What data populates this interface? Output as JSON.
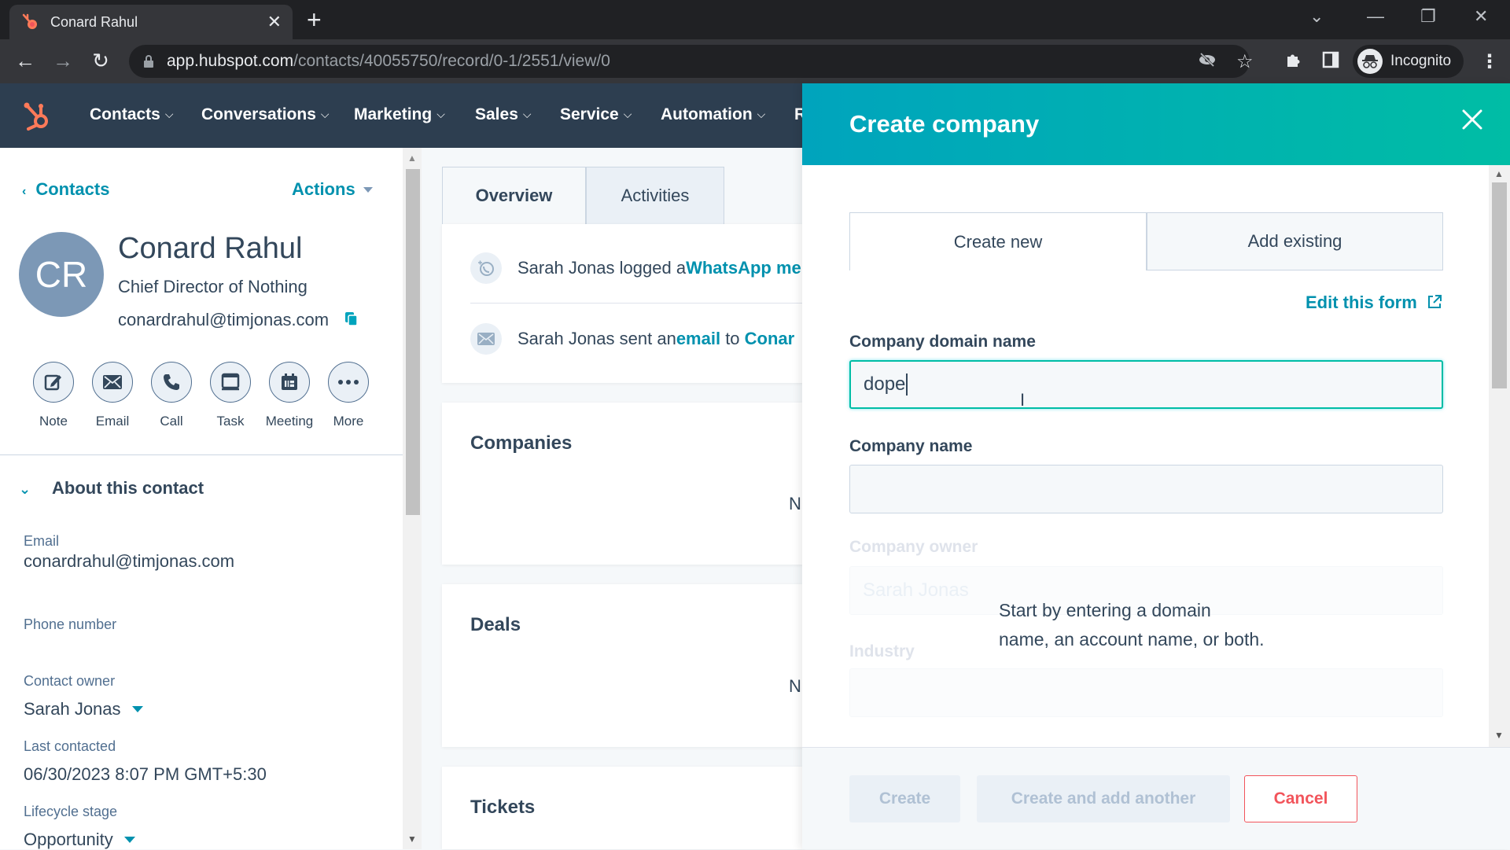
{
  "browser": {
    "tab_title": "Conard Rahul",
    "url_host": "app.hubspot.com",
    "url_path": "/contacts/40055750/record/0-1/2551/view/0",
    "profile_label": "Incognito"
  },
  "nav": {
    "items": [
      "Contacts",
      "Conversations",
      "Marketing",
      "Sales",
      "Service",
      "Automation",
      "R"
    ]
  },
  "sidebar": {
    "back_label": "Contacts",
    "actions_label": "Actions",
    "avatar_initials": "CR",
    "name": "Conard Rahul",
    "job_title": "Chief Director of Nothing",
    "email": "conardrahul@timjonas.com",
    "actions": [
      "Note",
      "Email",
      "Call",
      "Task",
      "Meeting",
      "More"
    ],
    "section_title": "About this contact",
    "properties": [
      {
        "label": "Email",
        "value": "conardrahul@timjonas.com"
      },
      {
        "label": "Phone number",
        "value": ""
      },
      {
        "label": "Contact owner",
        "value": "Sarah Jonas"
      },
      {
        "label": "Last contacted",
        "value": "06/30/2023 8:07 PM GMT+5:30"
      },
      {
        "label": "Lifecycle stage",
        "value": "Opportunity"
      }
    ]
  },
  "middle": {
    "tabs": [
      "Overview",
      "Activities"
    ],
    "activities": [
      {
        "pre": "Sarah Jonas logged a ",
        "link": "WhatsApp me",
        "post": ""
      },
      {
        "pre": "Sarah Jonas sent an ",
        "link": "email",
        "post": " to ",
        "link2": "Conar"
      }
    ],
    "cards": [
      {
        "title": "Companies",
        "truncated": "N"
      },
      {
        "title": "Deals",
        "truncated": "N"
      },
      {
        "title": "Tickets"
      }
    ]
  },
  "panel": {
    "title": "Create company",
    "tabs": [
      "Create new",
      "Add existing"
    ],
    "edit_form_label": "Edit this form",
    "fields": {
      "domain_label": "Company domain name",
      "domain_value": "dope",
      "name_label": "Company name",
      "name_value": "",
      "owner_label": "Company owner",
      "owner_value": "Sarah Jonas",
      "industry_label": "Industry",
      "industry_value": ""
    },
    "hint_line1": "Start by entering a domain",
    "hint_line2": "name, an account name, or both.",
    "buttons": {
      "create": "Create",
      "create_another": "Create and add another",
      "cancel": "Cancel"
    }
  }
}
